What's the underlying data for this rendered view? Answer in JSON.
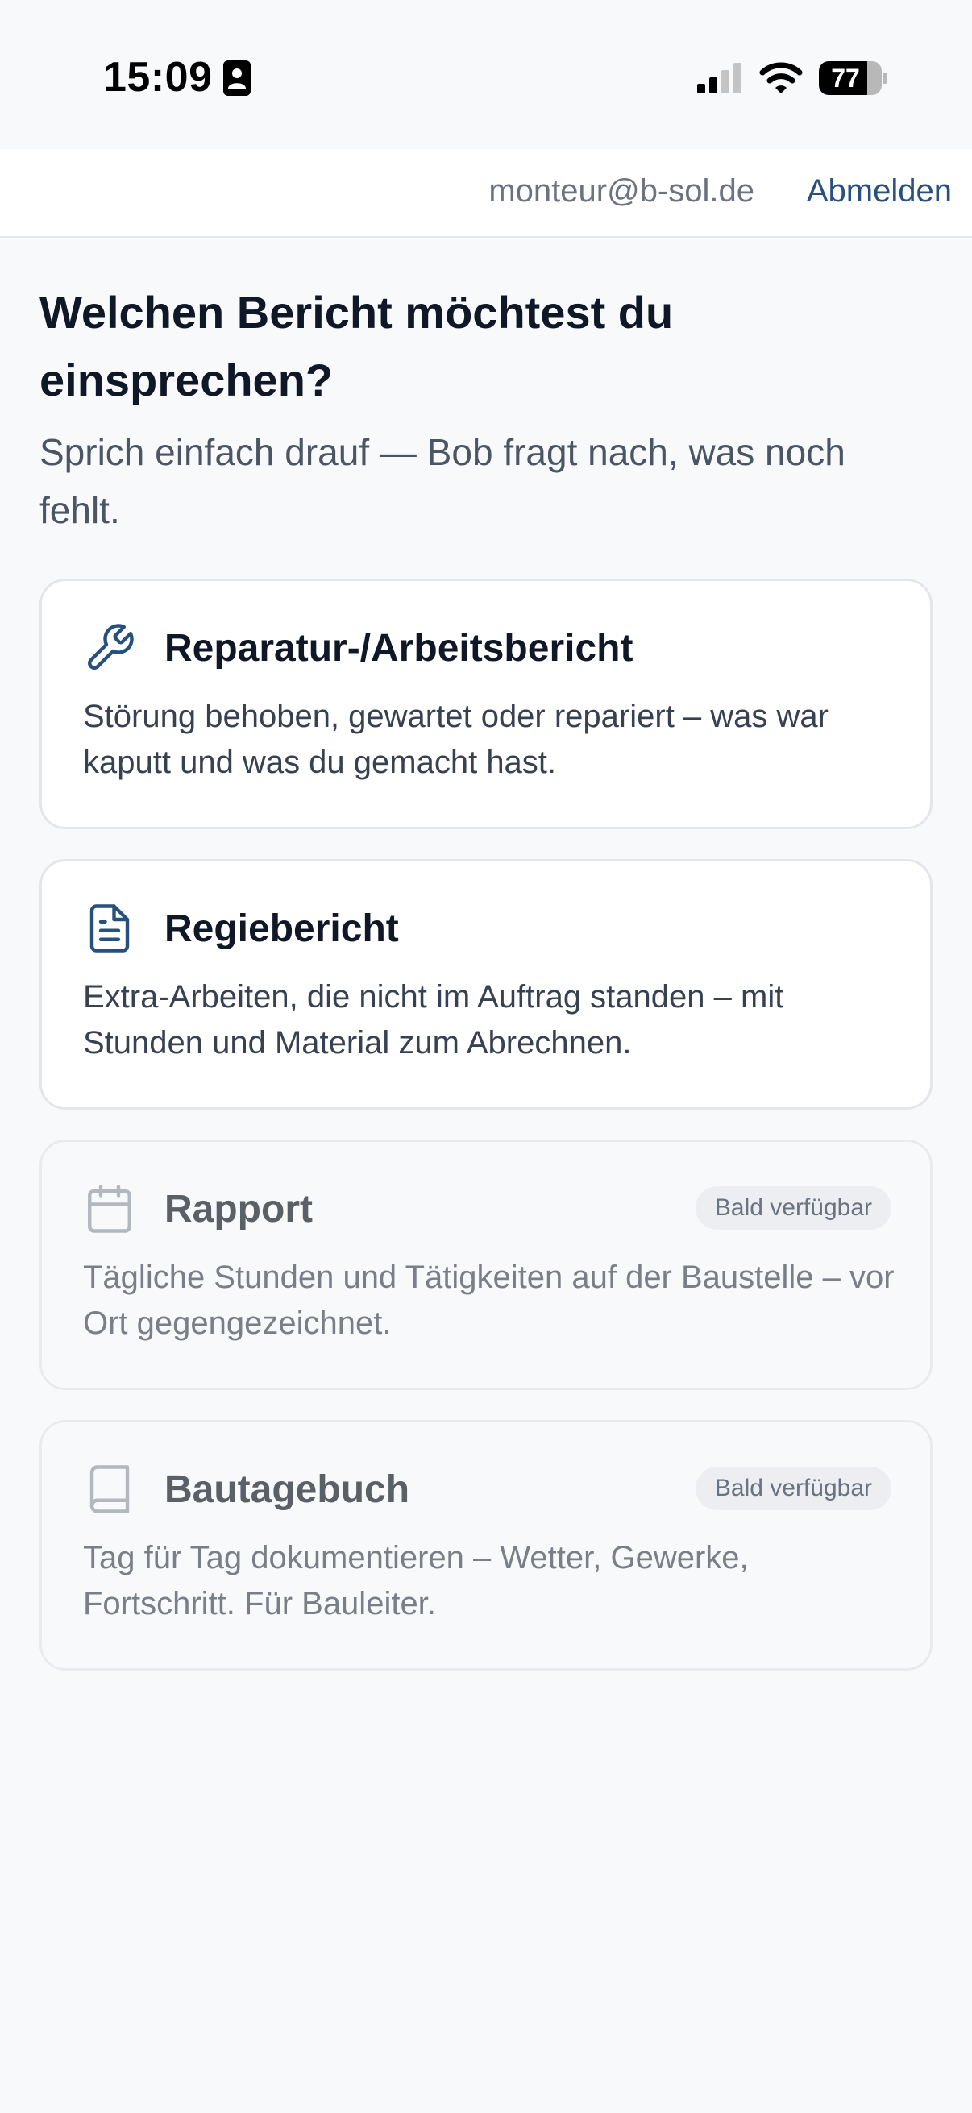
{
  "status_bar": {
    "time": "15:09",
    "battery_level": "77",
    "battery_fraction": 0.77
  },
  "header": {
    "email": "monteur@b-sol.de",
    "logout_label": "Abmelden"
  },
  "main": {
    "title": "Welchen Bericht möchtest du einsprechen?",
    "subtitle": "Sprich einfach drauf — Bob fragt nach, was noch fehlt.",
    "cards": [
      {
        "title": "Reparatur-/Arbeitsbericht",
        "description": "Störung behoben, gewartet oder repariert – was war kaputt und was du gemacht hast.",
        "icon": "wrench-icon",
        "enabled": true
      },
      {
        "title": "Regiebericht",
        "description": "Extra-Arbeiten, die nicht im Auftrag standen – mit Stunden und Material zum Abrechnen.",
        "icon": "document-icon",
        "enabled": true
      },
      {
        "title": "Rapport",
        "description": "Tägliche Stunden und Tätigkeiten auf der Baustelle – vor Ort gegengezeichnet.",
        "icon": "calendar-icon",
        "enabled": false,
        "badge": "Bald verfügbar"
      },
      {
        "title": "Bautagebuch",
        "description": "Tag für Tag dokumentieren – Wetter, Gewerke, Fortschritt. Für Bauleiter.",
        "icon": "book-icon",
        "enabled": false,
        "badge": "Bald verfügbar"
      }
    ]
  },
  "colors": {
    "accent": "#27507f",
    "background": "#f8f9fb",
    "card_background": "#ffffff",
    "border": "#e4e6ea",
    "title_text": "#101828",
    "muted_text": "#6b7280"
  }
}
